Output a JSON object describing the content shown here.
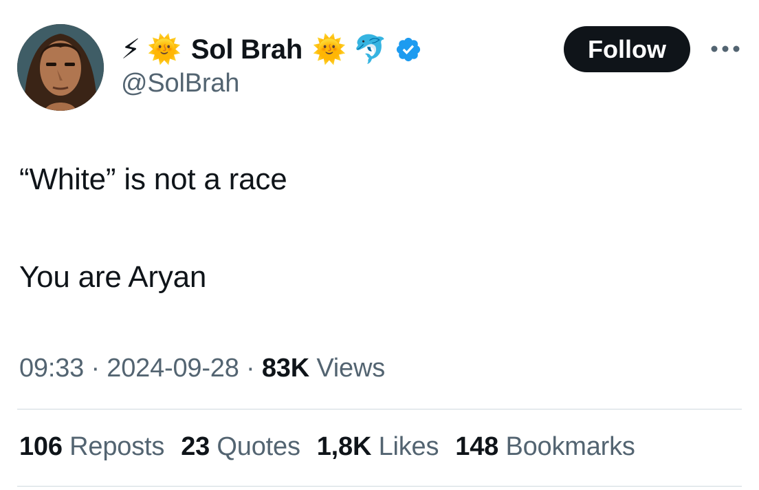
{
  "author": {
    "display_name": "Sol Brah",
    "handle": "@SolBrah",
    "prefix_emojis": [
      "⚡",
      "🌞"
    ],
    "suffix_emojis": [
      "🌞",
      "🐬"
    ],
    "verified_color": "#1d9bf0"
  },
  "follow_button": {
    "label": "Follow"
  },
  "tweet": {
    "lines": [
      "“White” is not a race",
      "You are Aryan"
    ]
  },
  "meta": {
    "time": "09:33",
    "separator": " · ",
    "date": "2024-09-28",
    "views_count": "83K",
    "views_label": "Views"
  },
  "stats": {
    "reposts": {
      "count": "106",
      "label": "Reposts"
    },
    "quotes": {
      "count": "23",
      "label": "Quotes"
    },
    "likes": {
      "count": "1,8K",
      "label": "Likes"
    },
    "bookmarks": {
      "count": "148",
      "label": "Bookmarks"
    }
  },
  "colors": {
    "text_primary": "#0f1419",
    "text_secondary": "#536471",
    "divider": "#cfd9de",
    "button_bg": "#0f1419"
  }
}
